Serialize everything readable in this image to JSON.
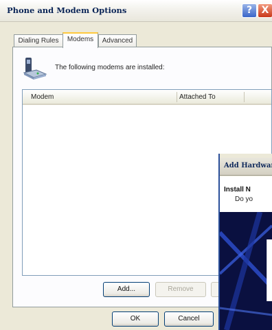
{
  "window": {
    "title": "Phone and Modem Options",
    "help_glyph": "?",
    "close_glyph": "X"
  },
  "tabs": [
    {
      "label": "Dialing Rules",
      "active": false
    },
    {
      "label": "Modems",
      "active": true
    },
    {
      "label": "Advanced",
      "active": false
    }
  ],
  "panel": {
    "intro": "The following modems are installed:",
    "list": {
      "columns": [
        "Modem",
        "Attached To"
      ],
      "rows": []
    },
    "buttons": {
      "add": "Add...",
      "remove": "Remove"
    }
  },
  "footer": {
    "ok": "OK",
    "cancel": "Cancel"
  },
  "child_window": {
    "title": "Add Hardware",
    "heading": "Install N",
    "subtext": "Do yo"
  },
  "colors": {
    "title_text": "#0a2456",
    "active_tab_accent": "#ffc83c",
    "button_border": "#003c74",
    "list_border": "#7f9db9",
    "wizard_dark": "#0a1040"
  },
  "icons": {
    "header": "modem-phone-icon"
  }
}
